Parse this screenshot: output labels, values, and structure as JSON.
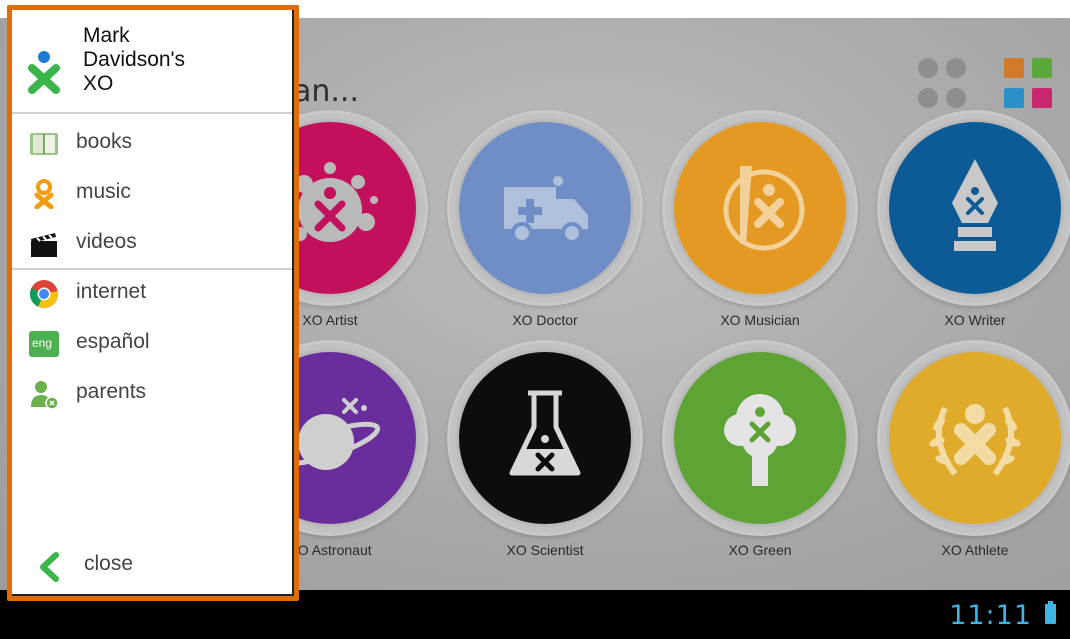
{
  "drawer": {
    "owner_name": "Mark\nDavidson's\nXO",
    "sections": [
      [
        {
          "label": "books",
          "icon": "book-icon"
        },
        {
          "label": "music",
          "icon": "music-icon"
        },
        {
          "label": "videos",
          "icon": "clapperboard-icon"
        }
      ],
      [
        {
          "label": "internet",
          "icon": "chrome-icon"
        },
        {
          "label": "español",
          "icon": "eng-badge-icon",
          "badge": "eng"
        },
        {
          "label": "parents",
          "icon": "parent-user-icon"
        }
      ]
    ],
    "close_label": "close",
    "border_color": "#e36c0a"
  },
  "screen": {
    "title_partial": "an...",
    "apps": [
      {
        "label": "XO Artist",
        "color": "#c3105d",
        "icon": "paint-splat-icon"
      },
      {
        "label": "XO Doctor",
        "color": "#6f8ec6",
        "icon": "ambulance-icon"
      },
      {
        "label": "XO Musician",
        "color": "#e49a22",
        "icon": "guitar-icon"
      },
      {
        "label": "XO Writer",
        "color": "#0c5a96",
        "icon": "pen-nib-icon"
      },
      {
        "label": "XO Astronaut",
        "color": "#6a2e9c",
        "icon": "planet-icon"
      },
      {
        "label": "XO Scientist",
        "color": "#0d0d0d",
        "icon": "flask-icon"
      },
      {
        "label": "XO Green",
        "color": "#5ea434",
        "icon": "tree-icon"
      },
      {
        "label": "XO Athlete",
        "color": "#e0aa2a",
        "icon": "laurel-icon"
      }
    ],
    "square_colors": [
      "#d27a2a",
      "#5aa83a",
      "#2b8fc8",
      "#c8266e"
    ]
  },
  "statusbar": {
    "time": "11:11",
    "accent": "#3db6e6"
  }
}
